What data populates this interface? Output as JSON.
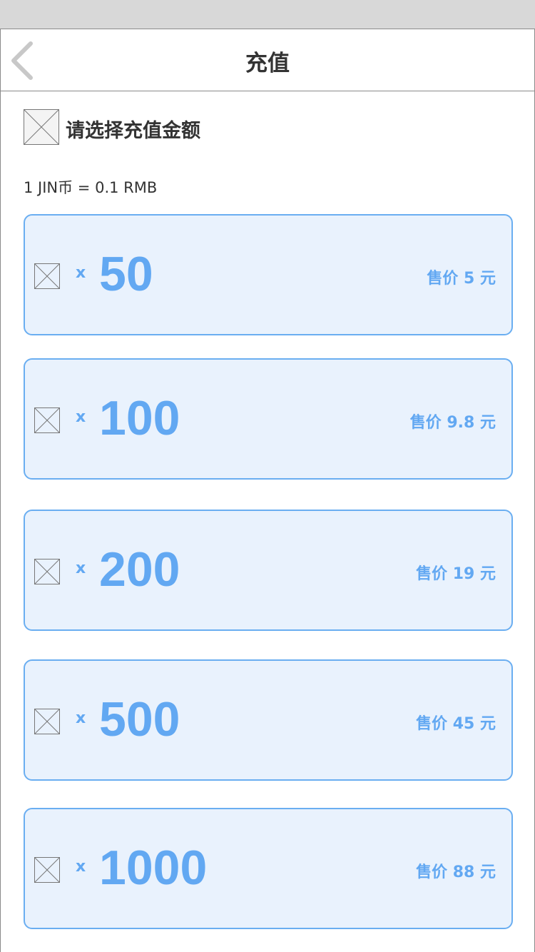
{
  "header": {
    "title": "充值"
  },
  "section": {
    "title": "请选择充值金额"
  },
  "rate": "1 JIN币 = 0.1 RMB",
  "options": [
    {
      "multiplier": "x",
      "amount": "50",
      "price": "售价 5 元"
    },
    {
      "multiplier": "x",
      "amount": "100",
      "price": "售价 9.8 元"
    },
    {
      "multiplier": "x",
      "amount": "200",
      "price": "售价 19 元"
    },
    {
      "multiplier": "x",
      "amount": "500",
      "price": "售价 45 元"
    },
    {
      "multiplier": "x",
      "amount": "1000",
      "price": "售价 88 元"
    }
  ],
  "colors": {
    "accent": "#62a8f2",
    "card_bg": "#e9f2fd",
    "card_border": "#6aaef1",
    "text": "#333333"
  }
}
